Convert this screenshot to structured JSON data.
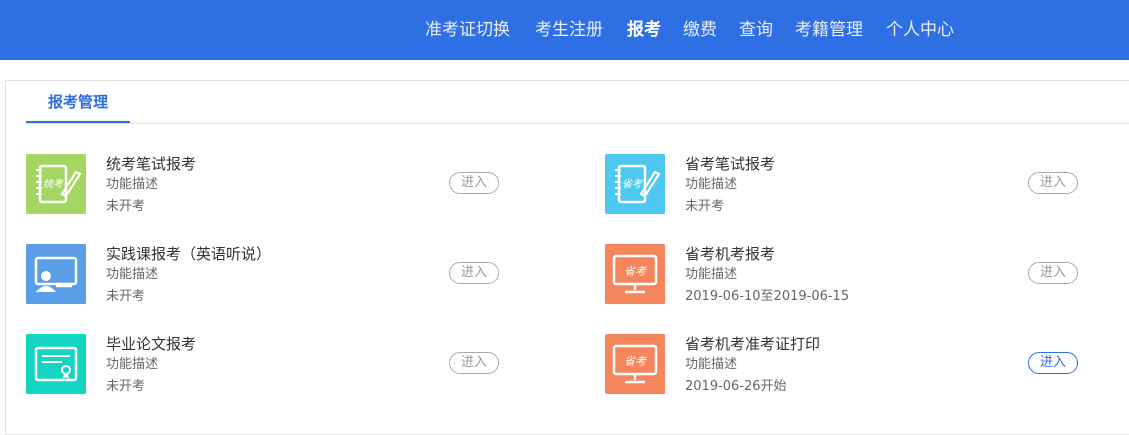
{
  "nav": {
    "items": [
      "准考证切换",
      "考生注册",
      "报考",
      "缴费",
      "查询",
      "考籍管理",
      "个人中心"
    ],
    "active_index": 2
  },
  "tab": {
    "label": "报考管理"
  },
  "enter_label": "进入",
  "colors": {
    "topbar": "#2f6fe4",
    "icon_green": "#a3d762",
    "icon_cyan": "#4dc8ef",
    "icon_blue": "#5a9ee8",
    "icon_orange": "#f5855d",
    "icon_teal": "#14d4c4"
  },
  "items": [
    {
      "title": "统考笔试报考",
      "desc": "功能描述",
      "status": "未开考",
      "icon": "notebook-tongkao-icon",
      "icon_text": "统考",
      "enter_active": false
    },
    {
      "title": "省考笔试报考",
      "desc": "功能描述",
      "status": "未开考",
      "icon": "notebook-shengkao-icon",
      "icon_text": "省考",
      "enter_active": false
    },
    {
      "title": "实践课报考（英语听说）",
      "desc": "功能描述",
      "status": "未开考",
      "icon": "teacher-board-icon",
      "enter_active": false
    },
    {
      "title": "省考机考报考",
      "desc": "功能描述",
      "status": "2019-06-10至2019-06-15",
      "icon": "monitor-shengkao-icon",
      "icon_text": "省考",
      "enter_active": false
    },
    {
      "title": "毕业论文报考",
      "desc": "功能描述",
      "status": "未开考",
      "icon": "certificate-icon",
      "enter_active": false
    },
    {
      "title": "省考机考准考证打印",
      "desc": "功能描述",
      "status": "2019-06-26开始",
      "icon": "monitor-shengkao-icon",
      "icon_text": "省考",
      "enter_active": true
    }
  ]
}
